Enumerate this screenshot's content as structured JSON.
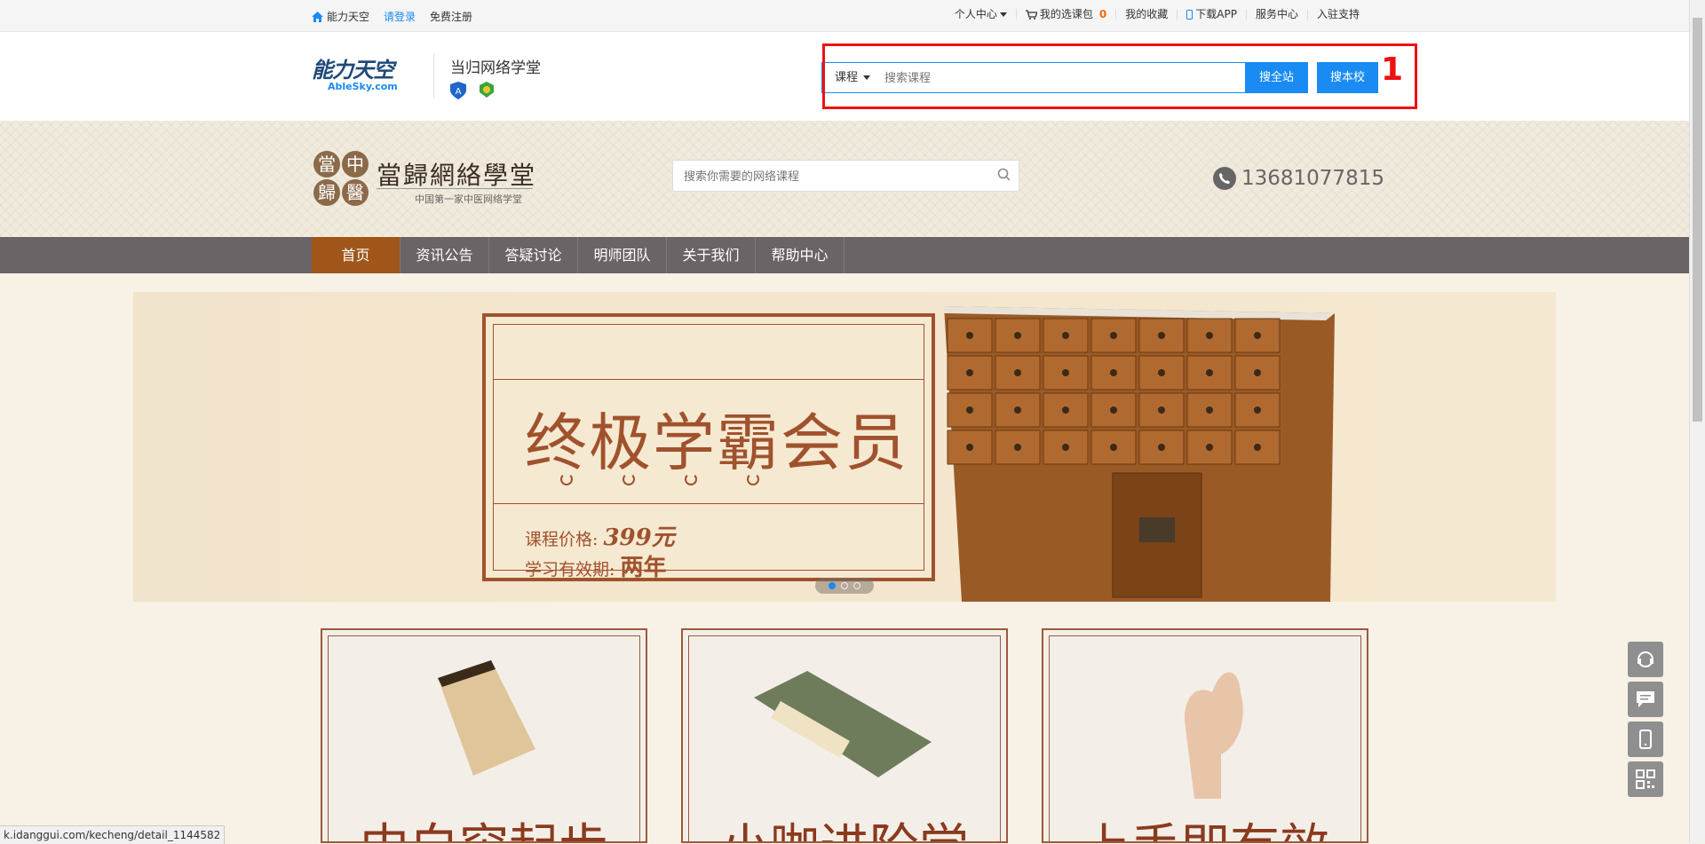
{
  "topbar": {
    "home": "能力天空",
    "login": "请登录",
    "register": "免费注册",
    "personal_center": "个人中心",
    "cart": "我的选课包",
    "cart_count": "0",
    "favorites": "我的收藏",
    "download_app": "下载APP",
    "service": "服务中心",
    "join": "入驻支持"
  },
  "header": {
    "brand_cn": "能力天空",
    "brand_en": "AbleSky.com",
    "school_name": "当归网络学堂",
    "search_type": "课程",
    "search_placeholder": "搜索课程",
    "btn_all": "搜全站",
    "btn_school": "搜本校",
    "annotation": "1"
  },
  "band": {
    "seals": [
      "當",
      "中",
      "歸",
      "醫"
    ],
    "title": "當歸網絡學堂",
    "subtitle": "中国第一家中医网络学堂",
    "search_placeholder": "搜索你需要的网络课程",
    "phone": "13681077815"
  },
  "nav": {
    "items": [
      "首页",
      "资讯公告",
      "答疑讨论",
      "明师团队",
      "关于我们",
      "帮助中心"
    ],
    "active_index": 0
  },
  "banner": {
    "title": "终极学霸会员",
    "price_label": "课程价格:",
    "price_value": "399元",
    "valid_label": "学习有效期:",
    "valid_value": "两年",
    "slides": 3,
    "active_slide": 0
  },
  "cards": [
    {
      "caption": "中白帘起步"
    },
    {
      "caption": "小咖进阶学"
    },
    {
      "caption": "上手即有效"
    }
  ],
  "status_url": "k.idanggui.com/kecheng/detail_1144582",
  "colors": {
    "accent": "#1a8bf2",
    "nav_bg": "#6a6466",
    "nav_active": "#a0561a",
    "banner_brown": "#a0522d",
    "highlight": "#ee1111"
  }
}
